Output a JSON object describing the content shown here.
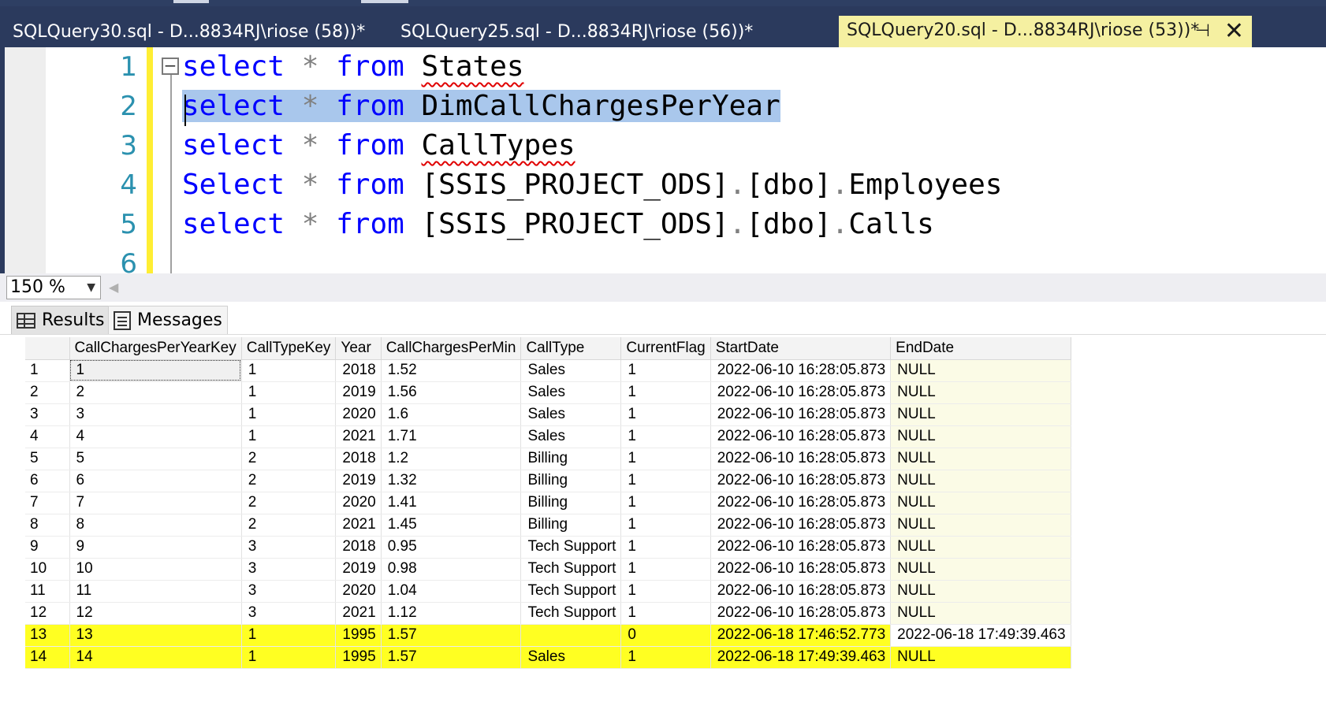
{
  "tabs": [
    {
      "label": "SQLQuery30.sql - D...8834RJ\\riose (58))*",
      "active": false
    },
    {
      "label": "SQLQuery25.sql - D...8834RJ\\riose (56))*",
      "active": false
    },
    {
      "label": "SQLQuery20.sql - D...8834RJ\\riose (53))*",
      "active": true
    }
  ],
  "tab_icons": {
    "pin": "pin-icon",
    "close": "close-icon",
    "pin_glyph": "⊣",
    "close_glyph": "✕"
  },
  "editor": {
    "lines": [
      {
        "num": "1",
        "kw1": "select",
        "op": "*",
        "kw2": "from",
        "rest": "States"
      },
      {
        "num": "2",
        "kw1": "select",
        "op": "*",
        "kw2": "from",
        "rest": "DimCallChargesPerYear"
      },
      {
        "num": "3",
        "kw1": "select",
        "op": "*",
        "kw2": "from",
        "rest": "CallTypes"
      },
      {
        "num": "4",
        "kw1": "Select",
        "op": "*",
        "kw2": "from",
        "r1": "[SSIS_PROJECT_ODS]",
        "d1": ".",
        "r2": "[dbo]",
        "d2": ".",
        "r3": "Employees"
      },
      {
        "num": "5",
        "kw1": "select",
        "op": "*",
        "kw2": "from",
        "r1": "[SSIS_PROJECT_ODS]",
        "d1": ".",
        "r2": "[dbo]",
        "d2": ".",
        "r3": "Calls"
      },
      {
        "num": "6"
      }
    ],
    "collapse_glyph": "−"
  },
  "zoom": {
    "value": "150 %",
    "arrow": "▼",
    "scroll_arrow": "◀"
  },
  "result_tabs": {
    "results": "Results",
    "messages": "Messages"
  },
  "grid": {
    "columns": [
      "CallChargesPerYearKey",
      "CallTypeKey",
      "Year",
      "CallChargesPerMin",
      "CallType",
      "CurrentFlag",
      "StartDate",
      "EndDate"
    ],
    "rows": [
      [
        "1",
        "1",
        "1",
        "2018",
        "1.52",
        "Sales",
        "1",
        "2022-06-10 16:28:05.873",
        "NULL"
      ],
      [
        "2",
        "2",
        "1",
        "2019",
        "1.56",
        "Sales",
        "1",
        "2022-06-10 16:28:05.873",
        "NULL"
      ],
      [
        "3",
        "3",
        "1",
        "2020",
        "1.6",
        "Sales",
        "1",
        "2022-06-10 16:28:05.873",
        "NULL"
      ],
      [
        "4",
        "4",
        "1",
        "2021",
        "1.71",
        "Sales",
        "1",
        "2022-06-10 16:28:05.873",
        "NULL"
      ],
      [
        "5",
        "5",
        "2",
        "2018",
        "1.2",
        "Billing",
        "1",
        "2022-06-10 16:28:05.873",
        "NULL"
      ],
      [
        "6",
        "6",
        "2",
        "2019",
        "1.32",
        "Billing",
        "1",
        "2022-06-10 16:28:05.873",
        "NULL"
      ],
      [
        "7",
        "7",
        "2",
        "2020",
        "1.41",
        "Billing",
        "1",
        "2022-06-10 16:28:05.873",
        "NULL"
      ],
      [
        "8",
        "8",
        "2",
        "2021",
        "1.45",
        "Billing",
        "1",
        "2022-06-10 16:28:05.873",
        "NULL"
      ],
      [
        "9",
        "9",
        "3",
        "2018",
        "0.95",
        "Tech Support",
        "1",
        "2022-06-10 16:28:05.873",
        "NULL"
      ],
      [
        "10",
        "10",
        "3",
        "2019",
        "0.98",
        "Tech Support",
        "1",
        "2022-06-10 16:28:05.873",
        "NULL"
      ],
      [
        "11",
        "11",
        "3",
        "2020",
        "1.04",
        "Tech Support",
        "1",
        "2022-06-10 16:28:05.873",
        "NULL"
      ],
      [
        "12",
        "12",
        "3",
        "2021",
        "1.12",
        "Tech Support",
        "1",
        "2022-06-10 16:28:05.873",
        "NULL"
      ],
      [
        "13",
        "13",
        "1",
        "1995",
        "1.57",
        "",
        "0",
        "2022-06-18 17:46:52.773",
        "2022-06-18 17:49:39.463"
      ],
      [
        "14",
        "14",
        "1",
        "1995",
        "1.57",
        "Sales",
        "1",
        "2022-06-18 17:49:39.463",
        "NULL"
      ]
    ],
    "highlighted_rows": [
      13,
      14
    ]
  },
  "colors": {
    "tabbar": "#2b3a5d",
    "active_tab": "#f5f0a1",
    "keyword": "#0000ff",
    "line_number": "#2b91af",
    "selection": "#a9c7ec",
    "highlighter": "#ffff22"
  }
}
